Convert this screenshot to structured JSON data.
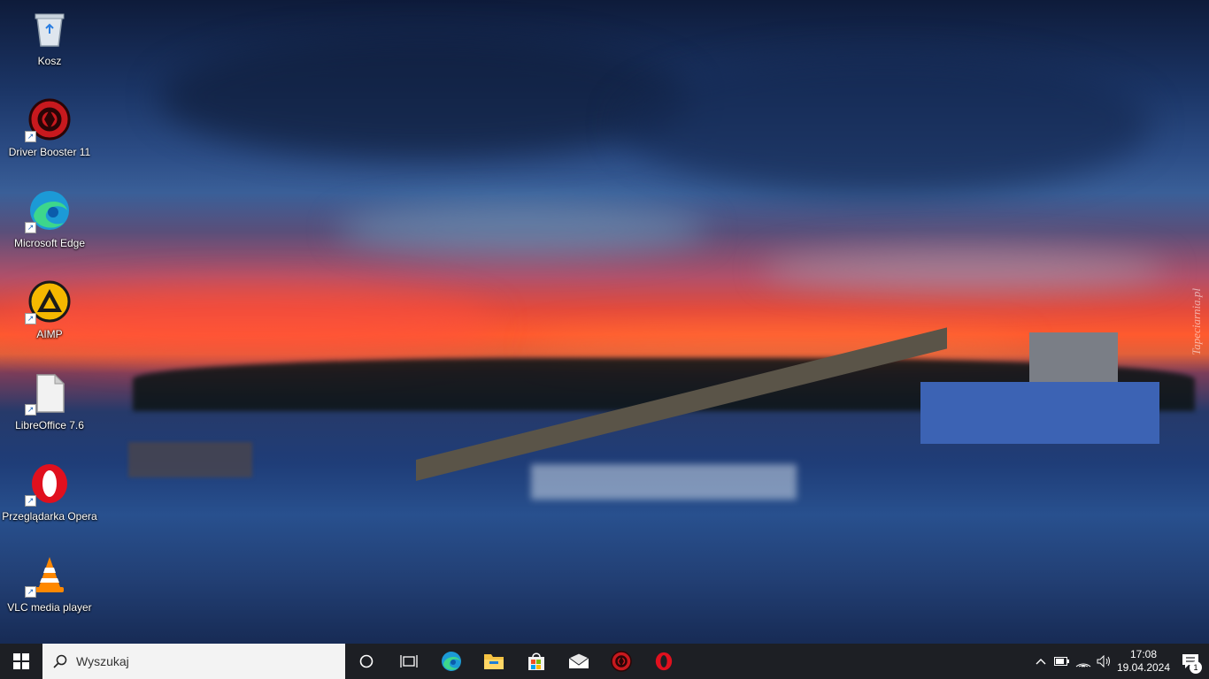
{
  "desktop": {
    "icons": [
      {
        "label": "Kosz",
        "icon": "recycle-bin-icon"
      },
      {
        "label": "Driver Booster 11",
        "icon": "driver-booster-icon"
      },
      {
        "label": "Microsoft Edge",
        "icon": "edge-icon"
      },
      {
        "label": "AIMP",
        "icon": "aimp-icon"
      },
      {
        "label": "LibreOffice 7.6",
        "icon": "libreoffice-icon"
      },
      {
        "label": "Przeglądarka Opera",
        "icon": "opera-icon"
      },
      {
        "label": "VLC media player",
        "icon": "vlc-icon"
      }
    ],
    "wallpaper_watermark": "Tapeciarnia.pl"
  },
  "taskbar": {
    "search_placeholder": "Wyszukaj",
    "pinned": [
      "cortana-icon",
      "task-view-icon",
      "edge-icon",
      "file-explorer-icon",
      "store-icon",
      "mail-icon",
      "driver-booster-icon",
      "opera-icon"
    ],
    "clock": {
      "time": "17:08",
      "date": "19.04.2024"
    },
    "notifications_count": "1"
  },
  "colors": {
    "taskbar": "#1d1f24",
    "accent": "#0078d4",
    "opera_red": "#e0101e",
    "booster_red": "#c8191e"
  }
}
